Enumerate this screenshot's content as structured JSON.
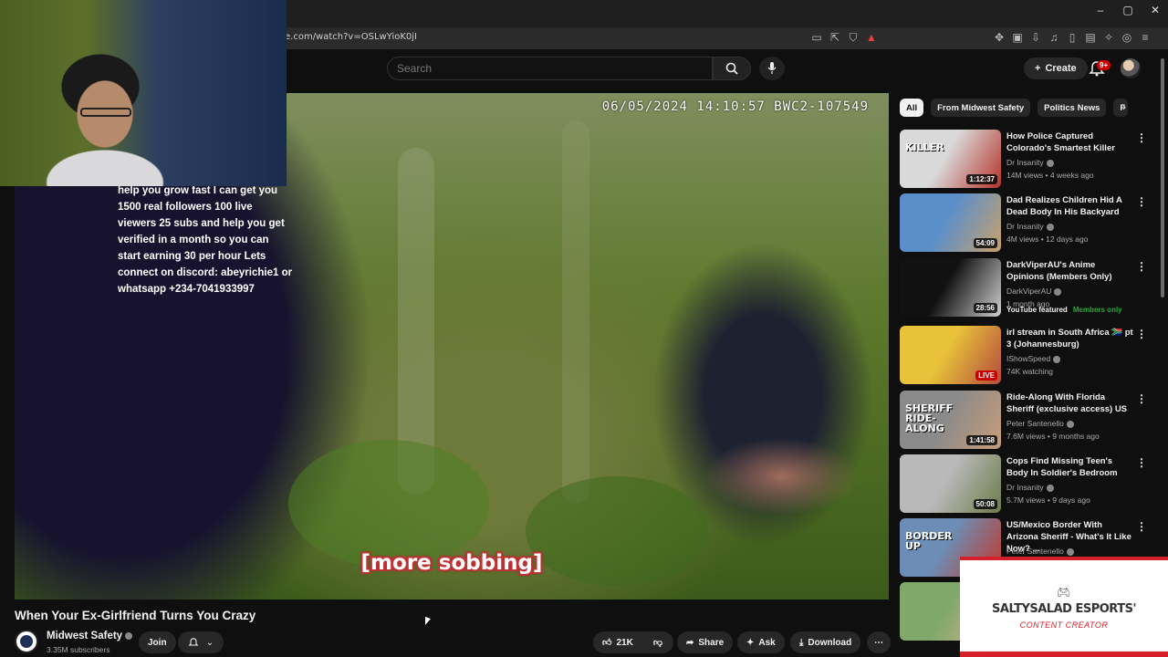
{
  "browser": {
    "url": "e.com/watch?v=OSLwYioK0jI",
    "window_controls": [
      "–",
      "▢",
      "✕"
    ]
  },
  "youtube": {
    "search_placeholder": "Search",
    "create_label": "Create",
    "notif_count": "9+"
  },
  "video": {
    "timestamp": "06/05/2024 14:10:57 BWC2-107549",
    "caption": "[more sobbing]",
    "overlay_text": "help you grow fast I can get you 1500 real followers 100 live viewers 25 subs and help you get verified in a month so you can start earning 30 per hour Lets connect on discord: abeyrichie1 or whatsapp +234-7041933997",
    "title": "When Your Ex-Girlfriend Turns You Crazy"
  },
  "channel": {
    "name": "Midwest Safety",
    "subscribers": "3.35M subscribers",
    "join_label": "Join"
  },
  "actions": {
    "likes": "21K",
    "share": "Share",
    "ask": "Ask",
    "download": "Download"
  },
  "chips": [
    "All",
    "From Midwest Safety",
    "Politics News",
    "F"
  ],
  "recommendations": [
    {
      "title": "How Police Captured Colorado's Smartest Killer",
      "channel": "Dr Insanity",
      "meta": "14M views • 4 weeks ago",
      "duration": "1:12:37",
      "thumb_text": "KILLER",
      "colors": [
        "#d9d9d9",
        "#b6332b"
      ]
    },
    {
      "title": "Dad Realizes Children Hid A Dead Body In His Backyard",
      "channel": "Dr Insanity",
      "meta": "4M views • 12 days ago",
      "duration": "54:09",
      "thumb_text": "",
      "colors": [
        "#5b8fc9",
        "#c9a16b"
      ]
    },
    {
      "title": "DarkViperAU's Anime Opinions (Members Only)",
      "channel": "DarkViperAU",
      "meta": "1 month ago",
      "duration": "28:56",
      "thumb_text": "",
      "colors": [
        "#111111",
        "#cfcfcf"
      ],
      "ribbon": "YouTube featured",
      "ribbon_tag": "Members only"
    },
    {
      "title": "irl stream in South Africa 🇿🇦 pt 3 (Johannesburg)",
      "channel": "IShowSpeed",
      "meta": "74K watching",
      "duration": "LIVE",
      "thumb_text": "",
      "colors": [
        "#e7c23a",
        "#b44a3c"
      ]
    },
    {
      "title": "Ride-Along With Florida Sheriff (exclusive access) US",
      "channel": "Peter Santenello",
      "meta": "7.6M views • 9 months ago",
      "duration": "1:41:58",
      "thumb_text": "SHERIFF RIDE-ALONG",
      "colors": [
        "#8a8a8a",
        "#c89d7a"
      ]
    },
    {
      "title": "Cops Find Missing Teen's Body In Soldier's Bedroom",
      "channel": "Dr Insanity",
      "meta": "5.7M views • 9 days ago",
      "duration": "50:08",
      "thumb_text": "",
      "colors": [
        "#b9b9b9",
        "#6d7b4a"
      ]
    },
    {
      "title": "US/Mexico Border With Arizona Sheriff - What's It Like Now? ...",
      "channel": "Peter Santenello",
      "meta": "",
      "duration": "",
      "thumb_text": "BORDER UP",
      "colors": [
        "#6c8db5",
        "#c03a2b"
      ]
    },
    {
      "title": "",
      "channel": "",
      "meta": "",
      "duration": "",
      "thumb_text": "",
      "colors": [
        "#7fa86a",
        "#d6b38e"
      ]
    }
  ],
  "brand": {
    "name": "SALTYSALAD ESPORTS'",
    "role": "CONTENT CREATOR"
  }
}
